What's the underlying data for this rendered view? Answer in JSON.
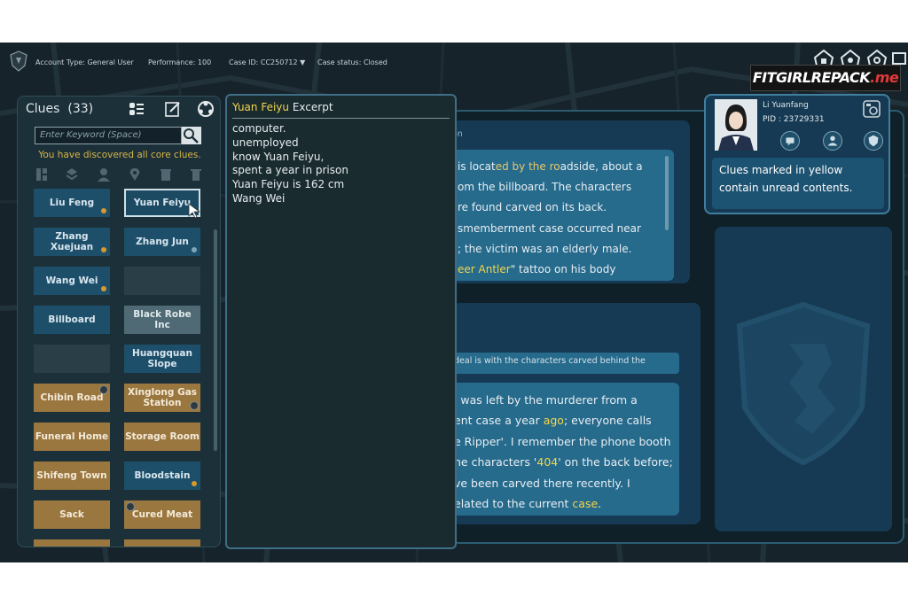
{
  "topbar": {
    "account": "Account Type: General User",
    "performance": "Performance: 100",
    "case_id": "Case ID: CC250712 ▼",
    "case_status": "Case status: Closed"
  },
  "watermark": {
    "main": "FITGIRLREPACK",
    "suffix": ".me"
  },
  "clues": {
    "title": "Clues",
    "count": "(33)",
    "search_placeholder": "Enter Keyword (Space)",
    "discovered": "You have discovered all core clues.",
    "cards": [
      {
        "label": "Liu Feng",
        "style": "blue",
        "dot": true
      },
      {
        "label": "Yuan Feiyu",
        "style": "sel",
        "dot": false
      },
      {
        "label": "Zhang Xuejuan",
        "style": "blue",
        "dot": true
      },
      {
        "label": "Zhang Jun",
        "style": "blue",
        "dot": false
      },
      {
        "label": "Wang Wei",
        "style": "blue",
        "dot": true
      },
      {
        "label": "",
        "style": "empty",
        "dot": false
      },
      {
        "label": "Billboard",
        "style": "blue",
        "dot": false
      },
      {
        "label": "Black Robe Inc",
        "style": "grey",
        "dot": false
      },
      {
        "label": "",
        "style": "empty",
        "dot": false
      },
      {
        "label": "Huangquan Slope",
        "style": "blue",
        "dot": false
      },
      {
        "label": "Chibin Road",
        "style": "orange",
        "dot": false
      },
      {
        "label": "Xinglong Gas Station",
        "style": "orange",
        "dot": false
      },
      {
        "label": "Funeral Home",
        "style": "orange",
        "dot": false
      },
      {
        "label": "Storage Room",
        "style": "orange",
        "dot": false
      },
      {
        "label": "Shifeng Town",
        "style": "orange",
        "dot": false
      },
      {
        "label": "Bloodstain",
        "style": "blue",
        "dot": true
      },
      {
        "label": "Sack",
        "style": "orange",
        "dot": false
      },
      {
        "label": "Cured Meat",
        "style": "orange",
        "dot": false
      }
    ]
  },
  "excerpt": {
    "name": "Yuan Feiyu",
    "suffix": " Excerpt",
    "lines": [
      "computer.",
      "unemployed",
      "know Yuan Feiyu,",
      "spent a year in prison",
      "Yuan Feiyu is 162 cm",
      "Wang Wei"
    ]
  },
  "case_box1": {
    "title_fragment": "on",
    "l1a": "is locat",
    "l1b": "ed by the ro",
    "l1c": "adside, about a",
    "l2": "om the billboard. The characters",
    "l3": "re found carved on its back.",
    "l4": "smemberment case occurred near",
    "l5": "; the victim was an elderly male.",
    "l6a": "eer Antler",
    "l6b": "\" tattoo on his body"
  },
  "case_box2": {
    "small": "deal is with the characters carved behind the",
    "l1": "' was left by the murderer from a",
    "l2a": "ent case a year ",
    "l2b": "ago",
    "l2c": "; everyone calls",
    "l3": "e Ripper'. I remember the phone booth",
    "l4a": "he characters '",
    "l4b": "404",
    "l4c": "' on the back before;",
    "l5": "ve been carved there recently. I",
    "l6a": "elated to the current ",
    "l6b": "case",
    "l6c": "."
  },
  "profile": {
    "name": "Li Yuanfang",
    "pid": "PID :  23729331",
    "tip": "Clues marked in yellow contain unread contents."
  }
}
